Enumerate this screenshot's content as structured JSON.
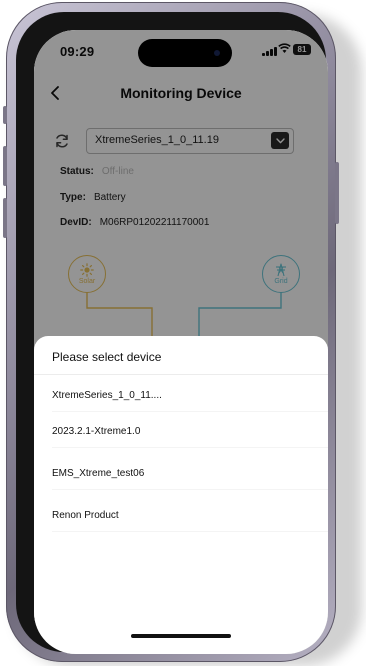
{
  "status_bar": {
    "time": "09:29",
    "battery": "81"
  },
  "header": {
    "title": "Monitoring Device"
  },
  "device_selector": {
    "selected": "XtremeSeries_1_0_11.19"
  },
  "info": {
    "status_label": "Status:",
    "status_value": "Off-line",
    "type_label": "Type:",
    "type_value": "Battery",
    "devid_label": "DevID:",
    "devid_value": "M06RP01202211170001"
  },
  "diagram": {
    "solar_label": "Solar",
    "grid_label": "Grid",
    "solar_color": "#e8c15a",
    "grid_color": "#6cc6d6"
  },
  "sheet": {
    "title": "Please select device",
    "options": [
      {
        "label": "XtremeSeries_1_0_11...."
      },
      {
        "label": "2023.2.1-Xtreme1.0"
      },
      {
        "label": "EMS_Xtreme_test06"
      },
      {
        "label": "Renon Product"
      }
    ]
  }
}
